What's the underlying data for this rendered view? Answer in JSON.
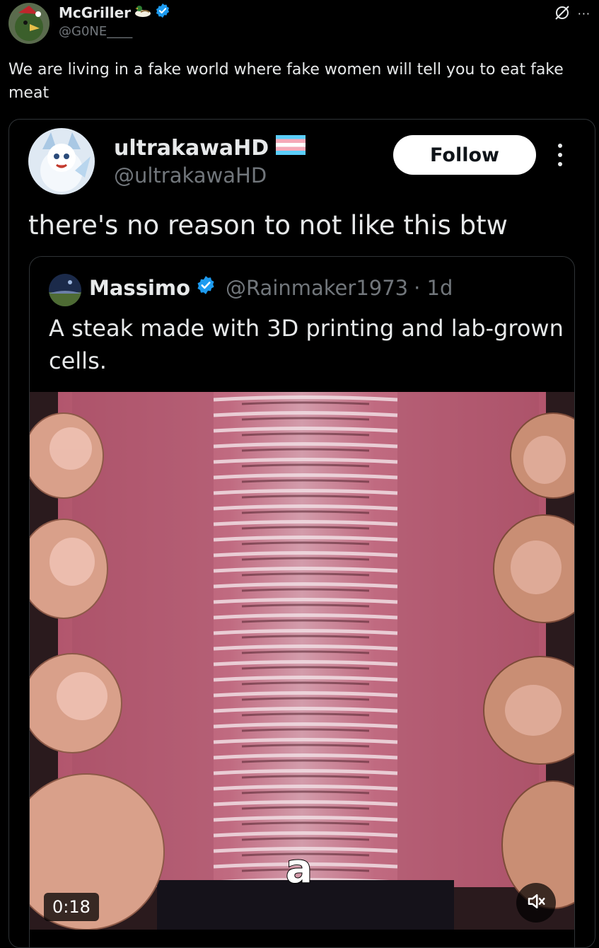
{
  "post": {
    "display_name": "McGriller",
    "handle": "@G0NE____",
    "text": "We are living in a fake world where fake women will tell you to eat fake meat",
    "more_icon": "more-horizontal-icon",
    "grok_icon": "grok-icon"
  },
  "embedded_post": {
    "display_name": "ultrakawaHD",
    "handle": "@ultrakawaHD",
    "follow_label": "Follow",
    "text": "there's no reason to not like this btw",
    "flag_icon": "trans-flag-icon"
  },
  "quoted_post": {
    "display_name": "Massimo",
    "handle": "@Rainmaker1973",
    "time": "· 1d",
    "text": "A steak made with 3D printing and lab-grown cells.",
    "video": {
      "duration": "0:18",
      "caption": "a",
      "muted": true
    }
  },
  "colors": {
    "background": "#000000",
    "text": "#e7e9ea",
    "secondary": "#71767b",
    "verified": "#1d9bf0",
    "border": "#2f3336"
  }
}
